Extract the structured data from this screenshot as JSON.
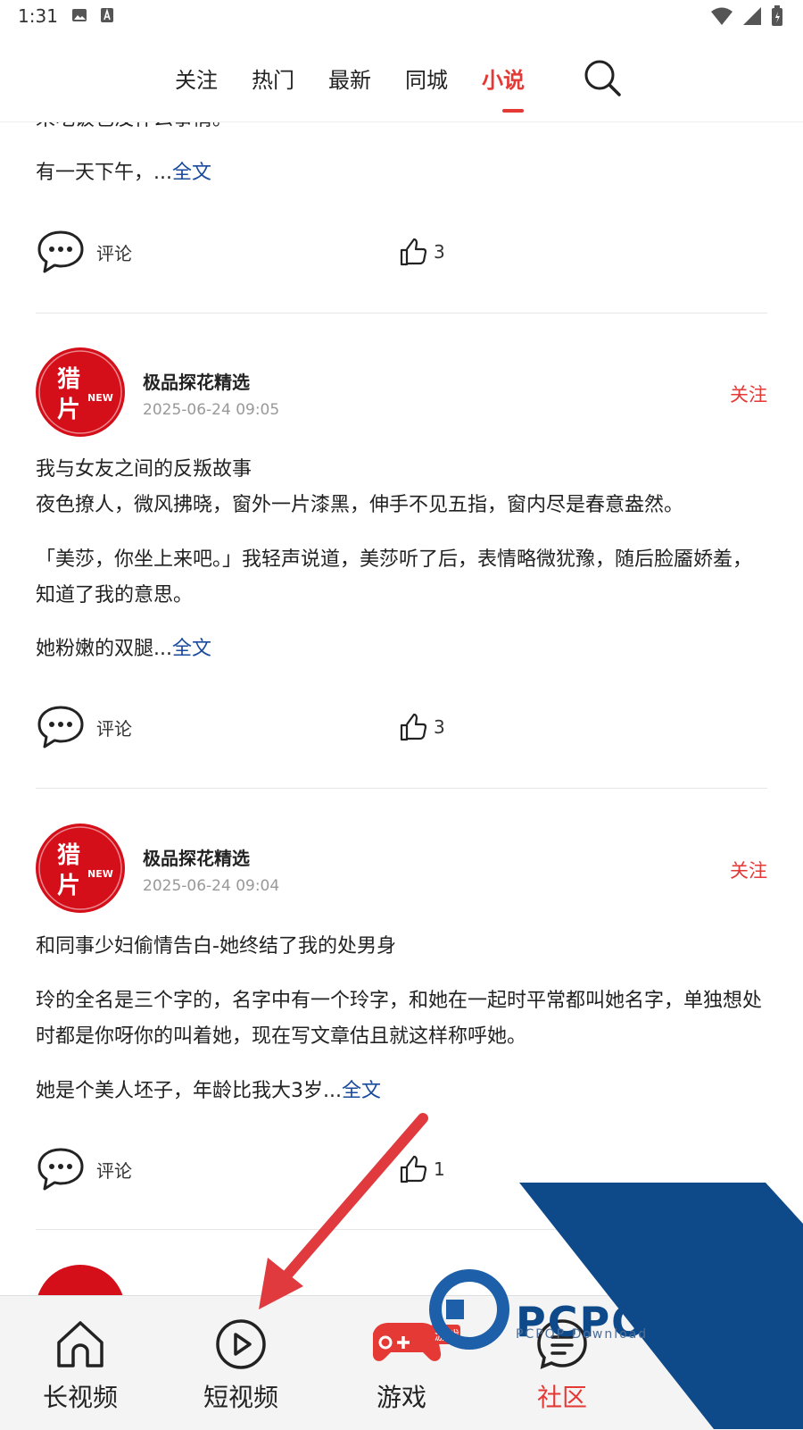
{
  "status_bar": {
    "time": "1:31"
  },
  "top_nav": {
    "tabs": [
      "关注",
      "热门",
      "最新",
      "同城",
      "小说"
    ],
    "active_tab": "小说"
  },
  "posts": [
    {
      "partial": true,
      "clipped_line": "来吃饭也没什么事情。",
      "paragraphs": [],
      "last_paragraph": "有一天下午，...",
      "more_label": "全文",
      "comment_label": "评论",
      "likes": "3"
    },
    {
      "author": "极品探花精选",
      "time": "2025-06-24 09:05",
      "follow_label": "关注",
      "avatar_text": [
        "猎",
        "片",
        "NEW"
      ],
      "title": "我与女友之间的反叛故事",
      "paragraphs": [
        "夜色撩人，微风拂晓，窗外一片漆黑，伸手不见五指，窗内尽是春意盎然。",
        "「美莎，你坐上来吧。」我轻声说道，美莎听了后，表情略微犹豫，随后脸靥娇羞，知道了我的意思。"
      ],
      "last_paragraph": "她粉嫩的双腿...",
      "more_label": "全文",
      "comment_label": "评论",
      "likes": "3"
    },
    {
      "author": "极品探花精选",
      "time": "2025-06-24 09:04",
      "follow_label": "关注",
      "avatar_text": [
        "猎",
        "片",
        "NEW"
      ],
      "title": "和同事少妇偷情告白-她终结了我的处男身",
      "paragraphs": [
        "玲的全名是三个字的，名字中有一个玲字，和她在一起时平常都叫她名字，单独想处时都是你呀你的叫着她，现在写文章估且就这样称呼她。"
      ],
      "last_paragraph": "她是个美人坯子，年龄比我大3岁...",
      "more_label": "全文",
      "comment_label": "评论",
      "likes": "1"
    }
  ],
  "bottom_nav": {
    "items": [
      {
        "label": "长视频",
        "icon": "house-icon"
      },
      {
        "label": "短视频",
        "icon": "play-circle-icon"
      },
      {
        "label": "游戏",
        "icon": "gamepad-icon",
        "badge": "游戏"
      },
      {
        "label": "社区",
        "icon": "community-icon",
        "active": true
      }
    ]
  },
  "watermark": {
    "brand": "PCPOP下载",
    "sub": "PCPOP Download"
  },
  "colors": {
    "accent": "#e53935",
    "link": "#1a4a9c",
    "avatar": "#d50f1a",
    "watermark_blue": "#0e4a8a"
  }
}
